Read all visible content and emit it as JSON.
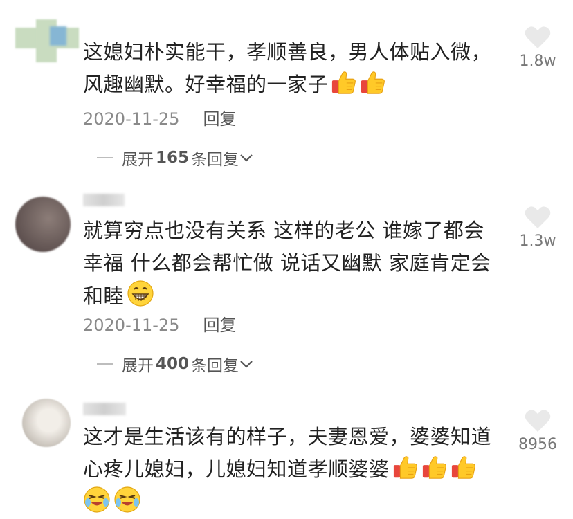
{
  "comments": [
    {
      "text_line1": "这媳妇朴实能干，孝顺善良，男人体贴入微，",
      "text_line2": "风趣幽默。好幸福的一家子",
      "emojis": [
        "thumbs-up-icon",
        "thumbs-up-icon"
      ],
      "date": "2020-11-25",
      "reply_label": "回复",
      "expand_prefix": "展开",
      "expand_count": "165",
      "expand_suffix": "条回复",
      "likes": "1.8w"
    },
    {
      "text_line1": "就算穷点也没有关系 这样的老公 谁嫁了都会",
      "text_line2": "幸福 什么都会帮忙做 说话又幽默 家庭肯定会",
      "text_line3": "和睦",
      "emojis": [
        "grin-icon"
      ],
      "date": "2020-11-25",
      "reply_label": "回复",
      "expand_prefix": "展开",
      "expand_count": "400",
      "expand_suffix": "条回复",
      "likes": "1.3w"
    },
    {
      "text_line1": "这才是生活该有的样子，夫妻恩爱，婆婆知道",
      "text_line2": "心疼儿媳妇，儿媳妇知道孝顺婆婆",
      "emojis": [
        "thumbs-up-icon",
        "thumbs-up-icon",
        "thumbs-up-icon",
        "wink-laugh-icon",
        "wink-laugh-icon"
      ],
      "likes": "8956"
    }
  ]
}
